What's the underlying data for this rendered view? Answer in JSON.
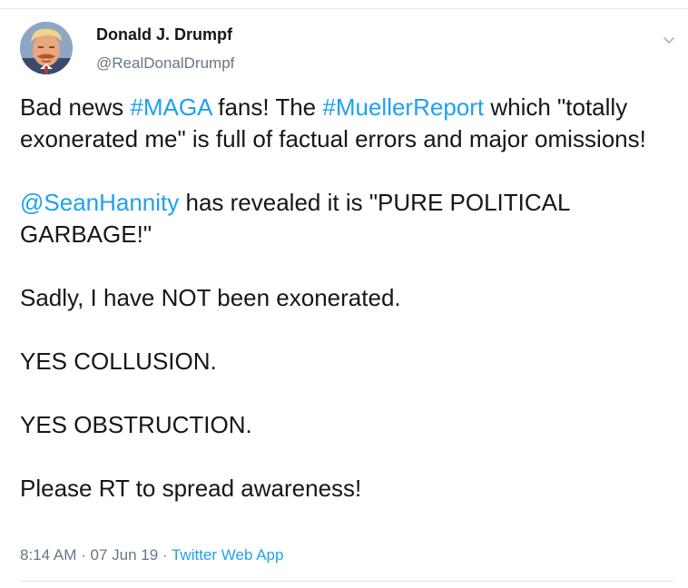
{
  "tweet": {
    "author": {
      "display_name": "Donald J. Drumpf",
      "handle": "@RealDonalDrumpf"
    },
    "menu_icon": "chevron-down-icon",
    "body": {
      "p1": {
        "t1": "Bad news ",
        "hashtag1": "#MAGA",
        "t2": " fans! The ",
        "hashtag2": "#MuellerReport",
        "t3": " which \"totally exonerated me\" is full of factual errors and major omissions!"
      },
      "p2": {
        "mention": "@SeanHannity",
        "t1": " has revealed it is \"PURE POLITICAL GARBAGE!\""
      },
      "p3": "Sadly, I have NOT been exonerated.",
      "p4": "YES COLLUSION.",
      "p5": "YES OBSTRUCTION.",
      "p6": "Please RT to spread awareness!"
    },
    "meta": {
      "time": "8:14 AM",
      "separator": " · ",
      "date": "07 Jun 19",
      "source": "Twitter Web App"
    },
    "colors": {
      "link": "#1da1f2",
      "text": "#14171a",
      "secondary": "#657786",
      "divider": "#e1e8ed"
    }
  }
}
